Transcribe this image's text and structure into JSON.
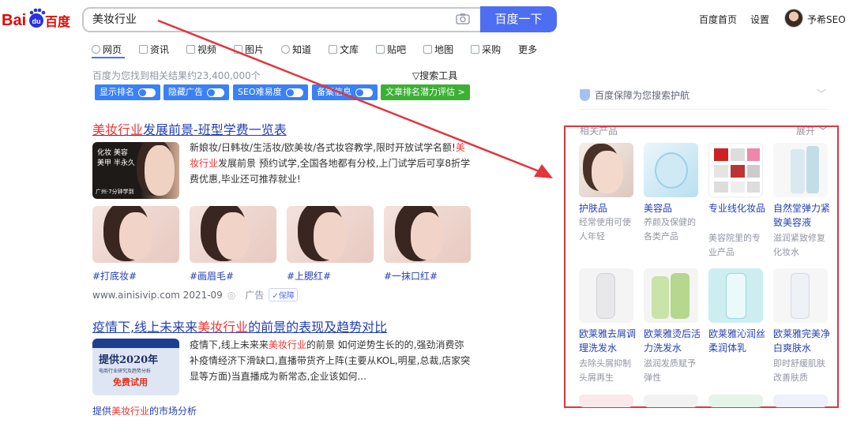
{
  "header": {
    "search_value": "美妆行业",
    "search_button": "百度一下",
    "links": [
      "百度首页",
      "设置"
    ],
    "username": "予希SEO"
  },
  "tabs": [
    "网页",
    "资讯",
    "视频",
    "图片",
    "知道",
    "文库",
    "贴吧",
    "地图",
    "采购",
    "更多"
  ],
  "result_count": "百度为您找到相关结果约23,400,000个",
  "search_tools": "搜索工具",
  "chips": [
    "显示排名",
    "隐藏广告",
    "SEO难易度",
    "备案信息",
    "文章排名潜力评估 >"
  ],
  "result1": {
    "title_hl": "美妆行业",
    "title_rest": "发展前景-班型学费一览表",
    "thumb_text": [
      "化妆 美容",
      "化妆 美容",
      "美甲 半永久",
      "广州·7分钟学到"
    ],
    "snippet_a": "新娘妆/日韩妆/生活妆/欧美妆/各式妆容教学,限时开放试学名额!",
    "snippet_hl": "美妆行业",
    "snippet_b": "发展前景 预约试学,全国各地都有分校,上门试学后可享8折学费优惠,毕业还可推荐就业!",
    "tags": [
      "#打底妆#",
      "#画眉毛#",
      "#上腮红#",
      "#一抹口红#"
    ],
    "source": "www.ainisivip.com 2021-09",
    "ad": "广告",
    "bao": "保障"
  },
  "result2": {
    "title_a": "疫情下,线上未来来",
    "title_hl": "美妆行业",
    "title_b": "的前景的表现及趋势对比",
    "thumb_line1": "提供2020年",
    "thumb_line2": "电商行业研究及趋势分析",
    "thumb_line3": "免费试用",
    "snippet_a": "疫情下,线上未来来",
    "snippet_hl": "美妆行业",
    "snippet_b": "的前景 如何逆势生长的的,强劲消费弥补疫情经济下滑缺口,直播带货齐上阵(主要从KOL,明星,总裁,店家突显等方面)当直播成为新常态,企业该如何...",
    "foot_a": "提供",
    "foot_hl": "美妆行业",
    "foot_b": "的市场分析"
  },
  "right": {
    "guard": "百度保障为您搜索护航",
    "label": "相关产品",
    "expand": "展开",
    "products": [
      {
        "name": "护肤品",
        "desc": "经常使用可使人年轻"
      },
      {
        "name": "美容品",
        "desc": "养颜及保健的各类产品"
      },
      {
        "name": "专业线化妆品",
        "desc": "美容院里的专业产品"
      },
      {
        "name": "自然堂弹力紧致美容液",
        "desc": "滋润紧致修复化妆水"
      },
      {
        "name": "欧莱雅去屑调理洗发水",
        "desc": "去除头屑抑制头屑再生"
      },
      {
        "name": "欧莱雅烫后活力洗发水",
        "desc": "滋润发质赋予弹性"
      },
      {
        "name": "欧莱雅沁润丝柔润体乳",
        "desc": ""
      },
      {
        "name": "欧莱雅完美净白爽肤水",
        "desc": "即时舒缓肌肤改善肤质"
      }
    ]
  }
}
